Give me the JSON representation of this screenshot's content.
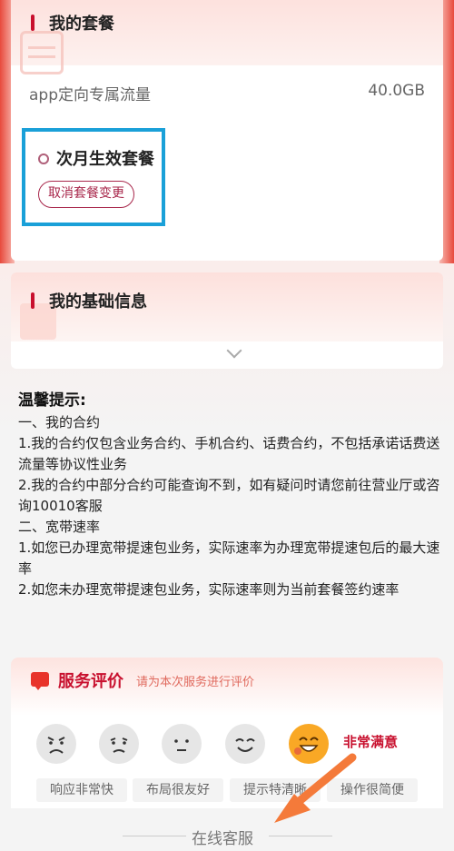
{
  "plan_card": {
    "title": "我的套餐",
    "flow_row": {
      "label": "app定向专属流量",
      "value": "40.0GB"
    },
    "next_month": {
      "title": "次月生效套餐",
      "cancel_button": "取消套餐变更"
    }
  },
  "basic_info_card": {
    "title": "我的基础信息"
  },
  "tips": {
    "title": "温馨提示:",
    "lines": [
      "一、我的合约",
      "1.我的合约仅包含业务合约、手机合约、话费合约，不包括承诺话费送流量等协议性业务",
      "2.我的合约中部分合约可能查询不到，如有疑问时请您前往营业厅或咨询10010客服",
      "二、宽带速率",
      "1.如您已办理宽带提速包业务，实际速率为办理宽带提速包后的最大速率",
      "2.如您未办理宽带提速包业务，实际速率则为当前套餐签约速率"
    ]
  },
  "evaluation": {
    "title": "服务评价",
    "subtitle": "请为本次服务进行评价",
    "selected_label": "非常满意",
    "faces": [
      "angry-face-icon",
      "sad-face-icon",
      "neutral-face-icon",
      "smile-face-icon",
      "happy-face-icon"
    ],
    "tags": [
      "响应非常快",
      "布局很友好",
      "提示特清晰",
      "操作很简便"
    ]
  },
  "online_service": "在线客服",
  "colors": {
    "brand_red": "#c8102e",
    "highlight_blue": "#1aa0d8",
    "arrow_orange": "#f47a3a"
  }
}
